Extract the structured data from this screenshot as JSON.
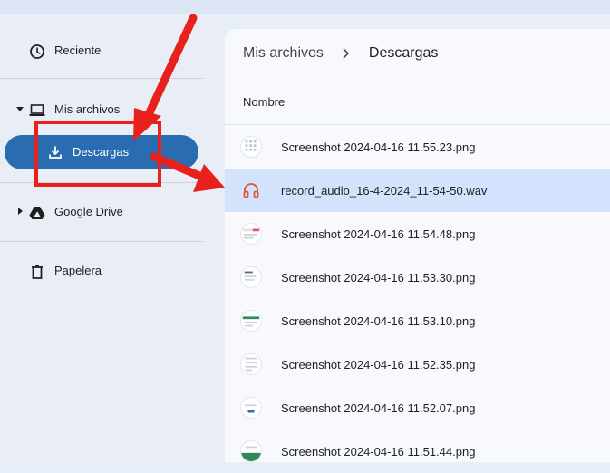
{
  "sidebar": {
    "recent": "Reciente",
    "my_files": "Mis archivos",
    "downloads": "Descargas",
    "google_drive": "Google Drive",
    "trash": "Papelera"
  },
  "main": {
    "breadcrumb": [
      "Mis archivos",
      "Descargas"
    ],
    "column_header": "Nombre",
    "files": [
      {
        "name": "Screenshot 2024-04-16 11.55.23.png",
        "type": "image"
      },
      {
        "name": "record_audio_16-4-2024_11-54-50.wav",
        "type": "audio",
        "selected": true
      },
      {
        "name": "Screenshot 2024-04-16 11.54.48.png",
        "type": "image"
      },
      {
        "name": "Screenshot 2024-04-16 11.53.30.png",
        "type": "image"
      },
      {
        "name": "Screenshot 2024-04-16 11.53.10.png",
        "type": "image"
      },
      {
        "name": "Screenshot 2024-04-16 11.52.35.png",
        "type": "image"
      },
      {
        "name": "Screenshot 2024-04-16 11.52.07.png",
        "type": "image"
      },
      {
        "name": "Screenshot 2024-04-16 11.51.44.png",
        "type": "image"
      }
    ]
  },
  "colors": {
    "selected_nav": "#2a6cb0",
    "selected_row": "#d3e3fd",
    "annotation": "#e8211c",
    "audio_icon": "#e0533d"
  },
  "icons": {
    "recent": "clock-icon",
    "my_files": "laptop-icon",
    "downloads": "download-icon",
    "google_drive": "drive-icon",
    "trash": "trash-icon",
    "audio": "headphones-icon"
  }
}
